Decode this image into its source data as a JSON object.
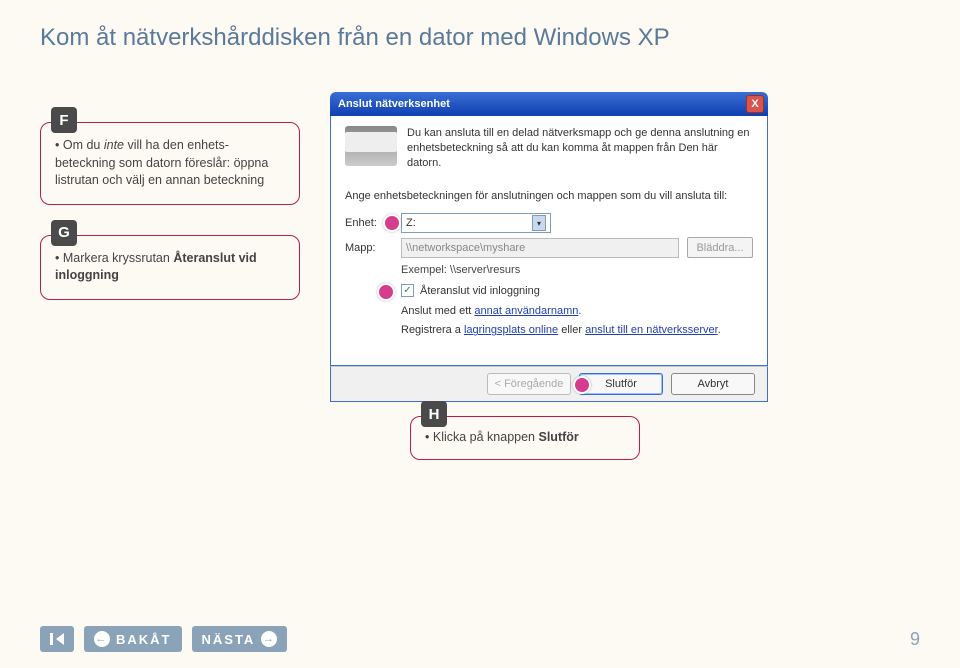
{
  "title": "Kom åt nätverkshårddisken från en dator med Windows XP",
  "steps": {
    "f": {
      "badge": "F",
      "text_pre": "Om du ",
      "text_ital": "inte",
      "text_post": " vill ha den enhets­beteckning som datorn föreslår: öppna listrutan och välj en annan beteckning"
    },
    "g": {
      "badge": "G",
      "text_pre": "Markera kryssrutan ",
      "bold": "Återanslut vid inloggning"
    },
    "h": {
      "badge": "H",
      "text_pre": "Klicka på knappen ",
      "bold": "Slutför"
    }
  },
  "dialog": {
    "title": "Anslut nätverksenhet",
    "close": "X",
    "desc": "Du kan ansluta till en delad nätverksmapp och ge denna anslutning en enhetsbeteckning så att du kan komma åt mappen från Den här datorn.",
    "desc2": "Ange enhetsbeteckningen för anslutningen och mappen som du vill ansluta till:",
    "enhet_label": "Enhet:",
    "enhet_value": "Z:",
    "mapp_label": "Mapp:",
    "mapp_placeholder": "\\\\networkspace\\myshare",
    "bladdra": "Bläddra...",
    "exempel": "Exempel: \\\\server\\resurs",
    "check_label": "Återanslut vid inloggning",
    "link1_pre": "Anslut med ett ",
    "link1": "annat användarnamn",
    "link1_post": ".",
    "link2_pre": "Registrera a ",
    "link2a": "lagringsplats online",
    "link2_mid": " eller ",
    "link2b": "anslut till en nätverksserver",
    "link2_post": ".",
    "btn_back": "< Föregående",
    "btn_finish": "Slutför",
    "btn_cancel": "Avbryt"
  },
  "footer": {
    "back": "BAKÅT",
    "next": "NÄSTA",
    "page": "9"
  }
}
